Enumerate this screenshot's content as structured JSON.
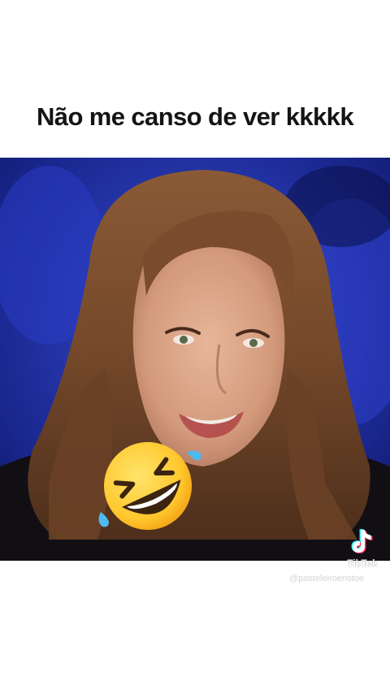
{
  "post": {
    "caption": "Não me canso de ver kkkkk"
  },
  "video": {
    "subject": "video-frame-woman-smiling",
    "background_color": "#1b2a8f"
  },
  "sticker": {
    "icon": "rolling-on-the-floor-laughing-emoji"
  },
  "watermark": {
    "brand_icon": "tiktok-logo-icon",
    "brand": "TikTok",
    "handle": "@pasteleiroenstoe"
  },
  "colors": {
    "background": "#ffffff",
    "caption_text": "#141414",
    "tiktok_cyan": "#25f4ee",
    "tiktok_red": "#fe2c55"
  }
}
